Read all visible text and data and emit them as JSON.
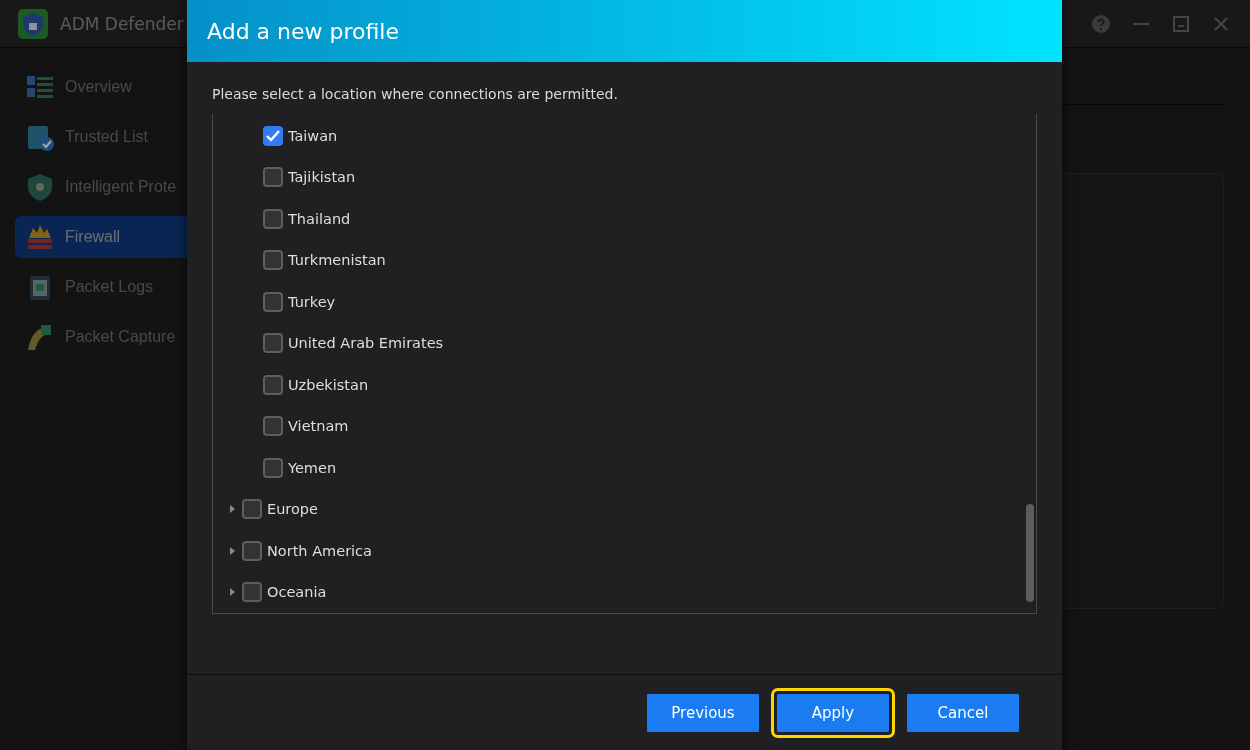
{
  "app": {
    "title": "ADM Defender"
  },
  "sidebar": {
    "items": [
      {
        "label": "Overview",
        "selected": false,
        "kind": "overview"
      },
      {
        "label": "Trusted List",
        "selected": false,
        "kind": "trusted"
      },
      {
        "label": "Intelligent Prote",
        "selected": false,
        "kind": "shield"
      },
      {
        "label": "Firewall",
        "selected": true,
        "kind": "firewall"
      },
      {
        "label": "Packet Logs",
        "selected": false,
        "kind": "logs"
      },
      {
        "label": "Packet Capture",
        "selected": false,
        "kind": "capture"
      }
    ]
  },
  "dialog": {
    "title": "Add a new profile",
    "instruction": "Please select a location where connections are permitted.",
    "countries": [
      {
        "label": "Taiwan",
        "checked": true
      },
      {
        "label": "Tajikistan",
        "checked": false
      },
      {
        "label": "Thailand",
        "checked": false
      },
      {
        "label": "Turkmenistan",
        "checked": false
      },
      {
        "label": "Turkey",
        "checked": false
      },
      {
        "label": "United Arab Emirates",
        "checked": false
      },
      {
        "label": "Uzbekistan",
        "checked": false
      },
      {
        "label": "Vietnam",
        "checked": false
      },
      {
        "label": "Yemen",
        "checked": false
      }
    ],
    "regions": [
      {
        "label": "Europe",
        "checked": false,
        "expanded": false
      },
      {
        "label": "North America",
        "checked": false,
        "expanded": false
      },
      {
        "label": "Oceania",
        "checked": false,
        "expanded": false
      }
    ],
    "buttons": [
      {
        "label": "Previous",
        "focused": false
      },
      {
        "label": "Apply",
        "focused": true
      },
      {
        "label": "Cancel",
        "focused": false
      }
    ]
  }
}
